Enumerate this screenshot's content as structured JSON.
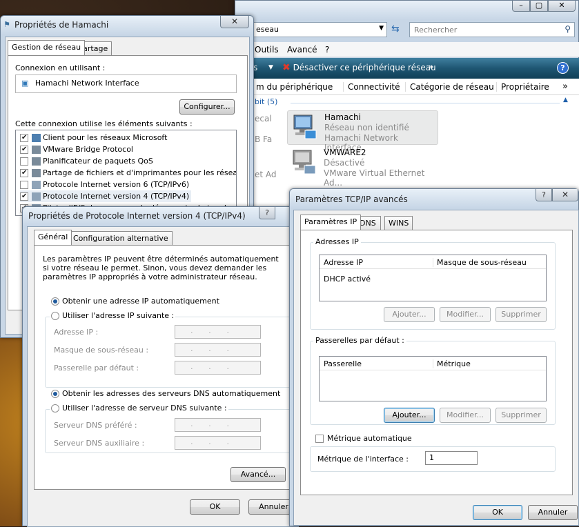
{
  "explorer": {
    "address": "eseau",
    "search_placeholder": "Rechercher",
    "menu": [
      "Outils",
      "Avancé",
      "?"
    ],
    "toolbar_left": "s",
    "toolbar_action": "Désactiver ce périphérique réseau",
    "toolbar_more": "»",
    "columns": [
      "m du périphérique",
      "Connectivité",
      "Catégorie de réseau",
      "Propriétaire"
    ],
    "columns_more": "»",
    "group_label": "bit (5)",
    "left_labels": [
      "ecal",
      "B Fa",
      "et Ad"
    ],
    "items": [
      {
        "name": "Hamachi",
        "status": "Réseau non identifié",
        "device": "Hamachi Network Interface"
      },
      {
        "name": "VMWARE2",
        "status": "Désactivé",
        "device": "VMware Virtual Ethernet Ad..."
      }
    ]
  },
  "hamachi": {
    "title": "Propriétés de Hamachi",
    "tabs": [
      "Gestion de réseau",
      "Partage"
    ],
    "connect_label": "Connexion en utilisant :",
    "adapter": "Hamachi Network Interface",
    "configure_btn": "Configurer...",
    "items_label": "Cette connexion utilise les éléments suivants :",
    "items": [
      {
        "label": "Client pour les réseaux Microsoft",
        "checked": true
      },
      {
        "label": "VMware Bridge Protocol",
        "checked": true
      },
      {
        "label": "Planificateur de paquets QoS",
        "checked": false
      },
      {
        "label": "Partage de fichiers et d'imprimantes pour les réseaux Mi...",
        "checked": true
      },
      {
        "label": "Protocole Internet version 6 (TCP/IPv6)",
        "checked": false
      },
      {
        "label": "Protocole Internet version 4 (TCP/IPv4)",
        "checked": true
      },
      {
        "label": "Pilote d'E/S du mappage de découverte de topologie d...",
        "checked": true
      }
    ]
  },
  "ipv4": {
    "title": "Propriétés de Protocole Internet version 4 (TCP/IPv4)",
    "help": "?",
    "tabs": [
      "Général",
      "Configuration alternative"
    ],
    "intro": "Les paramètres IP peuvent être déterminés automatiquement si votre réseau le permet. Sinon, vous devez demander les paramètres IP appropriés à votre administrateur réseau.",
    "auto_ip": "Obtenir une adresse IP automatiquement",
    "manual_ip": "Utiliser l'adresse IP suivante :",
    "ip_label": "Adresse IP :",
    "mask_label": "Masque de sous-réseau :",
    "gateway_label": "Passerelle par défaut :",
    "auto_dns": "Obtenir les adresses des serveurs DNS automatiquement",
    "manual_dns": "Utiliser l'adresse de serveur DNS suivante :",
    "dns1_label": "Serveur DNS préféré :",
    "dns2_label": "Serveur DNS auxiliaire :",
    "ip_dots": "...",
    "advanced_btn": "Avancé...",
    "ok": "OK",
    "cancel": "Annuler"
  },
  "advanced": {
    "title": "Paramètres TCP/IP avancés",
    "help": "?",
    "close": "✕",
    "tabs": [
      "Paramètres IP",
      "DNS",
      "WINS"
    ],
    "ip_group": "Adresses IP",
    "ip_cols": [
      "Adresse IP",
      "Masque de sous-réseau"
    ],
    "ip_rows": [
      "DHCP activé"
    ],
    "gw_group": "Passerelles par défaut :",
    "gw_cols": [
      "Passerelle",
      "Métrique"
    ],
    "add": "Ajouter...",
    "modify": "Modifier...",
    "remove": "Supprimer",
    "auto_metric": "Métrique automatique",
    "iface_metric_label": "Métrique de l'interface :",
    "iface_metric_value": "1",
    "ok": "OK",
    "cancel": "Annuler"
  }
}
